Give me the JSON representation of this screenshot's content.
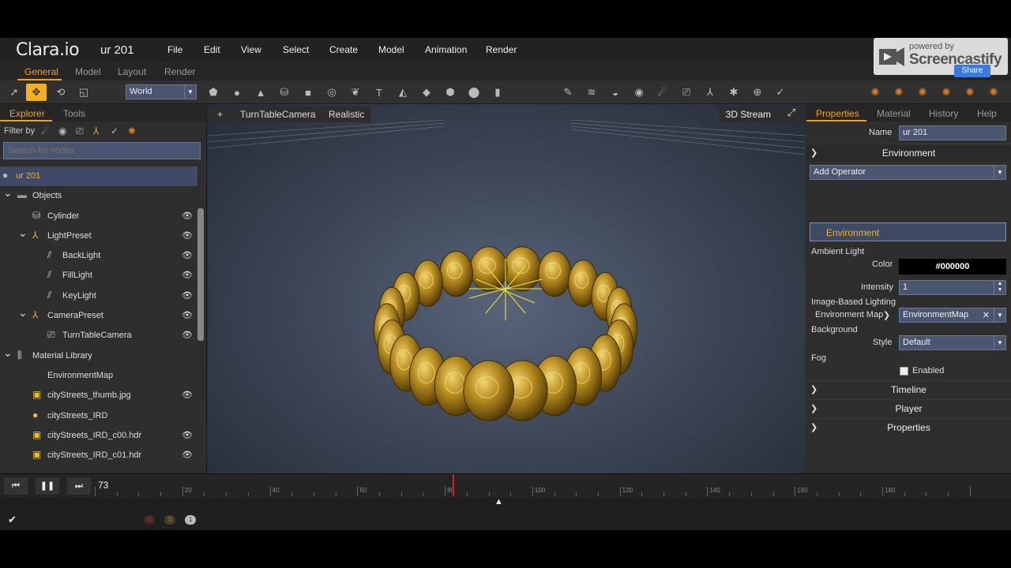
{
  "app": {
    "logo": "Clara.io",
    "scene_name": "ur 201",
    "menu": [
      "File",
      "Edit",
      "View",
      "Select",
      "Create",
      "Model",
      "Animation",
      "Render"
    ],
    "mode_tabs": [
      "General",
      "Model",
      "Layout",
      "Render"
    ],
    "active_mode": "General"
  },
  "toolbar": {
    "coordinate_space": "World",
    "icons": [
      "pointer-icon",
      "move-icon",
      "rotate-icon",
      "scale-icon",
      "box-icon",
      "sphere-icon",
      "cone-icon",
      "cylinder-icon",
      "plane-icon",
      "torus-icon",
      "teapot-icon",
      "text-icon",
      "pyramid-icon",
      "shape-icon",
      "geosphere-icon",
      "circle-icon",
      "capsule-icon",
      "paint-icon",
      "hair-icon",
      "disc-icon",
      "target-icon",
      "light-icon",
      "camera-icon",
      "transform-icon",
      "bone-icon",
      "add-icon",
      "check-icon",
      "material-icon"
    ]
  },
  "explorer": {
    "tabs": [
      "Explorer",
      "Tools"
    ],
    "filter_label": "Filter by",
    "search_placeholder": "Search for nodes",
    "tree": [
      {
        "label": "ur 201",
        "depth": 0,
        "icon": "scene-icon",
        "selected": true
      },
      {
        "label": "Objects",
        "depth": 0,
        "arrow": true,
        "icon": "folder-icon"
      },
      {
        "label": "Cylinder",
        "depth": 1,
        "icon": "cylinder-icon",
        "eye": true
      },
      {
        "label": "LightPreset",
        "depth": 1,
        "arrow": true,
        "icon": "rig-icon",
        "eye": true
      },
      {
        "label": "BackLight",
        "depth": 2,
        "icon": "light-icon",
        "eye": true
      },
      {
        "label": "FillLight",
        "depth": 2,
        "icon": "light-icon",
        "eye": true
      },
      {
        "label": "KeyLight",
        "depth": 2,
        "icon": "light-icon",
        "eye": true
      },
      {
        "label": "CameraPreset",
        "depth": 1,
        "arrow": true,
        "icon": "rig-icon",
        "eye": true
      },
      {
        "label": "TurnTableCamera",
        "depth": 2,
        "icon": "camera-icon",
        "eye": true
      },
      {
        "label": "Material Library",
        "depth": 0,
        "arrow": true,
        "icon": "library-icon"
      },
      {
        "label": "EnvironmentMap",
        "depth": 1,
        "icon": "none"
      },
      {
        "label": "cityStreets_thumb.jpg",
        "depth": 1,
        "icon": "image-icon",
        "eye": true
      },
      {
        "label": "cityStreets_IRD",
        "depth": 1,
        "icon": "sphere-map-icon"
      },
      {
        "label": "cityStreets_IRD_c00.hdr",
        "depth": 1,
        "icon": "image-icon",
        "eye": true
      },
      {
        "label": "cityStreets_IRD_c01.hdr",
        "depth": 1,
        "icon": "image-icon",
        "eye": true
      }
    ]
  },
  "viewport": {
    "add_label": "+",
    "camera": "TurnTableCamera",
    "shading": "Realistic",
    "stream_label": "3D Stream"
  },
  "properties": {
    "tabs": [
      "Properties",
      "Material",
      "History",
      "Help"
    ],
    "name_label": "Name",
    "name_value": "ur 201",
    "environment_header": "Environment",
    "add_operator": "Add Operator",
    "environment_item": "Environment",
    "ambient_light_label": "Ambient Light",
    "color_label": "Color",
    "color_value": "#000000",
    "intensity_label": "Intensity",
    "intensity_value": "1",
    "ibl_label": "Image-Based Lighting",
    "env_map_label": "Environment Map",
    "env_map_value": "EnvironmentMap",
    "background_label": "Background",
    "style_label": "Style",
    "style_value": "Default",
    "fog_label": "Fog",
    "enabled_label": "Enabled",
    "sections": [
      "Timeline",
      "Player",
      "Properties"
    ]
  },
  "timeline": {
    "current_frame": "73",
    "tick_labels": [
      "20",
      "40",
      "60",
      "80",
      "100",
      "120",
      "140",
      "160",
      "180"
    ],
    "max_frame": 200
  },
  "status": {
    "badges": [
      "0",
      "0",
      "1"
    ],
    "badge_colors": [
      "#5a2a2a",
      "#5a4a1a",
      "#bbbbbb"
    ]
  },
  "watermark": {
    "powered_by": "powered by",
    "brand": "Screencastify",
    "share": "Share"
  }
}
